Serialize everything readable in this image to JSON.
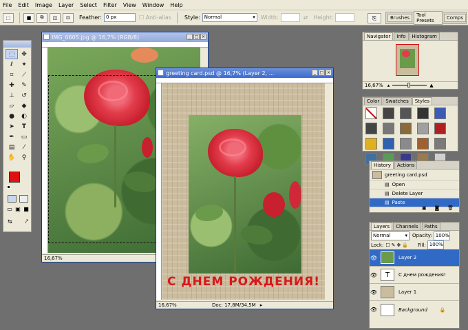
{
  "menu": [
    "File",
    "Edit",
    "Image",
    "Layer",
    "Select",
    "Filter",
    "View",
    "Window",
    "Help"
  ],
  "options": {
    "feather_label": "Feather:",
    "feather_value": "0 px",
    "antialias_label": "Anti-alias",
    "style_label": "Style:",
    "style_value": "Normal",
    "width_label": "Width:",
    "height_label": "Height:"
  },
  "dock": {
    "tabs": [
      "Brushes",
      "Tool Presets",
      "Comps"
    ]
  },
  "doc1": {
    "title": "IMG_0605.jpg @ 16,7% (RGB/8)",
    "zoom": "16,67%"
  },
  "doc2": {
    "title": "greeting card.psd @ 16,7% (Layer 2, ...",
    "greeting": "С ДНЕМ РОЖДЕНИЯ!",
    "zoom": "16,67%",
    "doc_size": "Doc: 17,8M/34,5M"
  },
  "navigator": {
    "tabs": [
      "Navigator",
      "Info",
      "Histogram"
    ],
    "zoom": "16,67%"
  },
  "styles_panel": {
    "tabs": [
      "Color",
      "Swatches",
      "Styles"
    ]
  },
  "history": {
    "tabs": [
      "History",
      "Actions"
    ],
    "snapshot": "greeting card.psd",
    "items": [
      "Open",
      "Delete Layer",
      "Paste"
    ]
  },
  "layers": {
    "tabs": [
      "Layers",
      "Channels",
      "Paths"
    ],
    "blend_mode": "Normal",
    "opacity_label": "Opacity:",
    "opacity_value": "100%",
    "lock_label": "Lock:",
    "fill_label": "Fill:",
    "fill_value": "100%",
    "items": [
      "Layer 2",
      "С днем рождения!",
      "Layer 1",
      "Background"
    ]
  },
  "colors": {
    "accent": "#3a6ad0",
    "foreground_swatch": "#e01010",
    "greeting_text": "#d81818",
    "selected_row": "#316ac5"
  },
  "style_swatches": [
    "#ffffff",
    "#444444",
    "#555555",
    "#333333",
    "#3d5bb4",
    "#444444",
    "#777777",
    "#8a6a3a",
    "#a0a0a0",
    "#b02020",
    "#e0b020",
    "#3060b0",
    "#8a8a8a",
    "#a06030",
    "#7a7a7a",
    "#4070a0",
    "#5a9a5a",
    "#3a3a8a",
    "#9a7a50",
    "#d0d0d0"
  ]
}
